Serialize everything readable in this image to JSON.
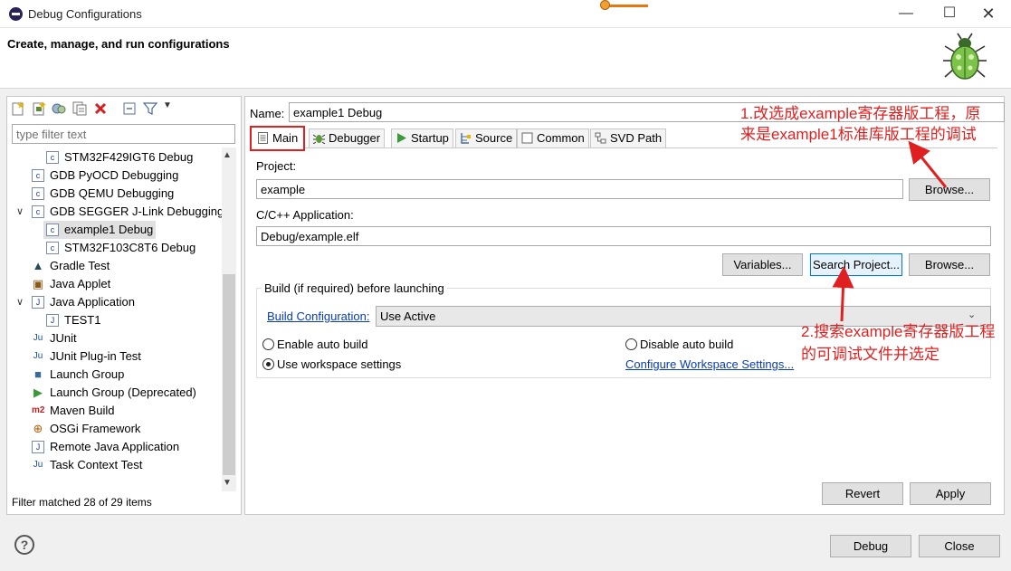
{
  "window": {
    "title": "Debug Configurations"
  },
  "header": {
    "title": "Create, manage, and run configurations"
  },
  "filter": {
    "placeholder": "type filter text",
    "status": "Filter matched 28 of 29 items"
  },
  "tree": [
    {
      "label": "STM32F429IGT6 Debug",
      "indent": 2,
      "icon": "c-config-icon"
    },
    {
      "label": "GDB PyOCD Debugging",
      "indent": 1,
      "icon": "c-config-icon"
    },
    {
      "label": "GDB QEMU Debugging",
      "indent": 1,
      "icon": "c-config-icon"
    },
    {
      "label": "GDB SEGGER J-Link Debugging",
      "indent": 1,
      "icon": "c-config-icon",
      "expanded": true
    },
    {
      "label": "example1 Debug",
      "indent": 2,
      "icon": "c-config-icon",
      "selected": true
    },
    {
      "label": "STM32F103C8T6 Debug",
      "indent": 2,
      "icon": "c-config-icon"
    },
    {
      "label": "Gradle Test",
      "indent": 1,
      "icon": "gradle-icon"
    },
    {
      "label": "Java Applet",
      "indent": 1,
      "icon": "java-applet-icon"
    },
    {
      "label": "Java Application",
      "indent": 1,
      "icon": "java-app-icon",
      "expanded": true
    },
    {
      "label": "TEST1",
      "indent": 2,
      "icon": "java-app-icon"
    },
    {
      "label": "JUnit",
      "indent": 1,
      "icon": "junit-icon"
    },
    {
      "label": "JUnit Plug-in Test",
      "indent": 1,
      "icon": "junit-plugin-icon"
    },
    {
      "label": "Launch Group",
      "indent": 1,
      "icon": "launch-group-icon"
    },
    {
      "label": "Launch Group (Deprecated)",
      "indent": 1,
      "icon": "launch-deprecated-icon"
    },
    {
      "label": "Maven Build",
      "indent": 1,
      "icon": "maven-icon"
    },
    {
      "label": "OSGi Framework",
      "indent": 1,
      "icon": "osgi-icon"
    },
    {
      "label": "Remote Java Application",
      "indent": 1,
      "icon": "remote-java-icon"
    },
    {
      "label": "Task Context Test",
      "indent": 1,
      "icon": "task-context-icon"
    }
  ],
  "config": {
    "name_label": "Name:",
    "name_value": "example1 Debug",
    "tabs": [
      {
        "label": "Main",
        "icon": "main-tab-icon"
      },
      {
        "label": "Debugger",
        "icon": "debugger-icon"
      },
      {
        "label": "Startup",
        "icon": "startup-icon"
      },
      {
        "label": "Source",
        "icon": "source-icon"
      },
      {
        "label": "Common",
        "icon": "common-icon"
      },
      {
        "label": "SVD Path",
        "icon": "svd-icon"
      }
    ],
    "project_label": "Project:",
    "project_value": "example",
    "browse1": "Browse...",
    "app_label": "C/C++ Application:",
    "app_value": "Debug/example.elf",
    "variables_btn": "Variables...",
    "search_btn": "Search Project...",
    "browse2": "Browse...",
    "build_group_label": "Build (if required) before launching",
    "build_config_link": "Build Configuration:",
    "build_config_value": "Use Active",
    "enable_auto_build": "Enable auto build",
    "disable_auto_build": "Disable auto build",
    "use_workspace": "Use workspace settings",
    "configure_workspace": "Configure Workspace Settings...",
    "revert_btn": "Revert",
    "apply_btn": "Apply"
  },
  "footer": {
    "debug_btn": "Debug",
    "close_btn": "Close",
    "help": "?"
  },
  "annotations": {
    "a1_line1": "1.改选成example寄存器版工程，原",
    "a1_line2": "来是example1标准库版工程的调试",
    "a2_line1": "2.搜索example寄存器版工程",
    "a2_line2": "的可调试文件并选定"
  },
  "colors": {
    "annotation": "#e02020",
    "link": "#0a3cb4",
    "focus": "#0078d7"
  }
}
